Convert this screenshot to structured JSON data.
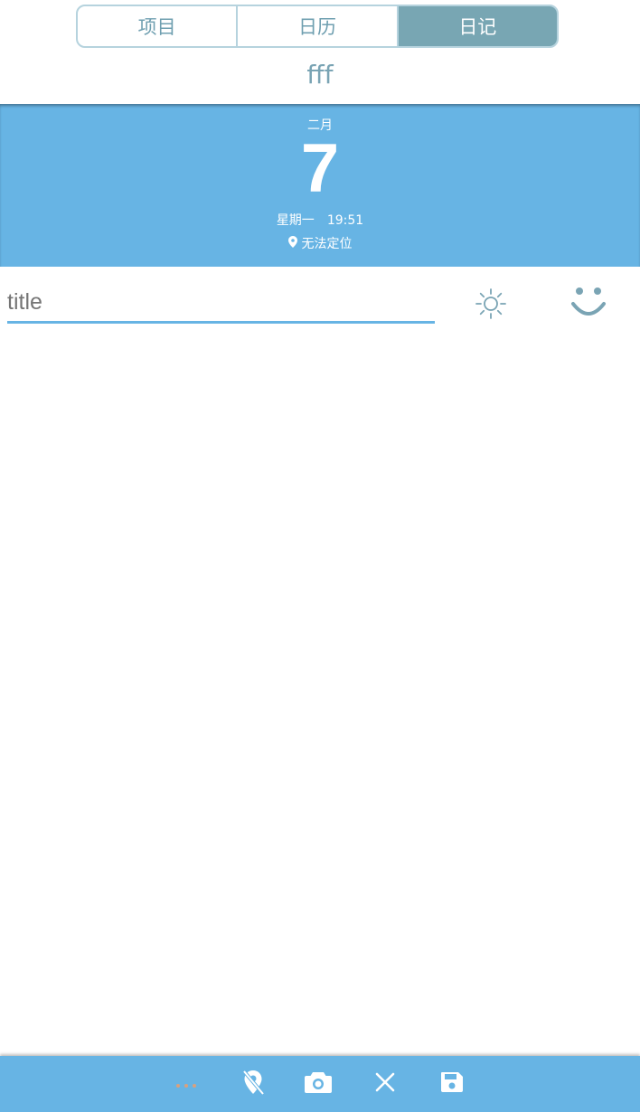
{
  "tabs": [
    {
      "label": "项目",
      "active": false
    },
    {
      "label": "日历",
      "active": false
    },
    {
      "label": "日记",
      "active": true
    }
  ],
  "notebook_name": "fff",
  "date": {
    "month": "二月",
    "day": "7",
    "weekday": "星期一",
    "time": "19:51",
    "location": "无法定位"
  },
  "entry": {
    "title_placeholder": "title"
  },
  "toolbar": {
    "icons": [
      "more-icon",
      "location-off-icon",
      "camera-icon",
      "close-icon",
      "save-icon"
    ]
  },
  "colors": {
    "accent": "#67b4e4",
    "tab_active": "#78a6b3",
    "tab_text": "#6f9fb0",
    "more_dots": "#d9a07e"
  }
}
